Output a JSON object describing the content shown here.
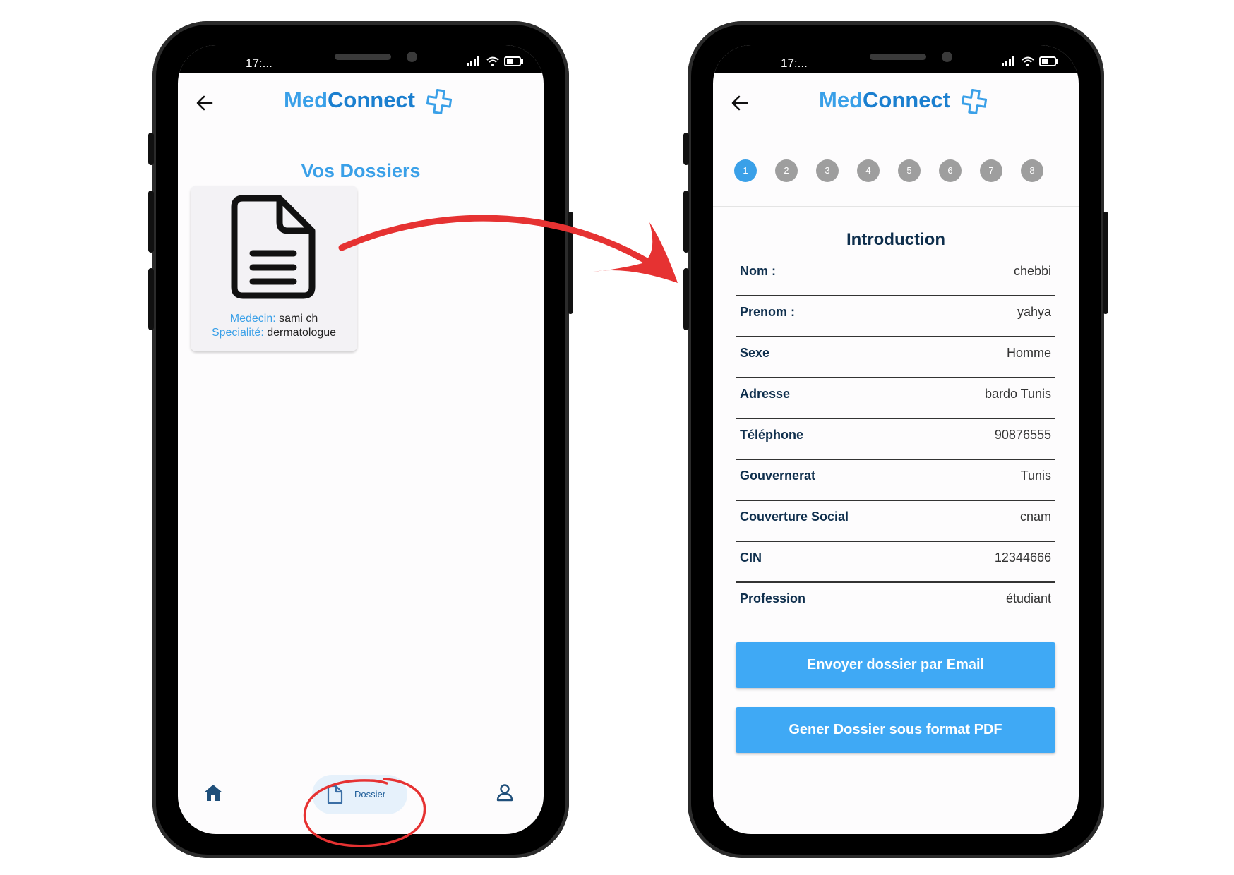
{
  "left_screen": {
    "status_time": "17:...",
    "app_title_part1": "Med",
    "app_title_part2": "Connect",
    "page_title": "Vos Dossiers",
    "card": {
      "medecin_label": "Medecin:",
      "medecin_value": "sami ch",
      "specialite_label": "Specialité:",
      "specialite_value": "dermatologue"
    },
    "nav": {
      "dossier_label": "Dossier"
    }
  },
  "right_screen": {
    "status_time": "17:...",
    "app_title_part1": "Med",
    "app_title_part2": "Connect",
    "steps": [
      "1",
      "2",
      "3",
      "4",
      "5",
      "6",
      "7",
      "8"
    ],
    "active_step": "1",
    "section_title": "Introduction",
    "rows": [
      {
        "label": "Nom :",
        "value": "chebbi"
      },
      {
        "label": "Prenom :",
        "value": "yahya"
      },
      {
        "label": "Sexe",
        "value": "Homme"
      },
      {
        "label": "Adresse",
        "value": "bardo Tunis"
      },
      {
        "label": "Téléphone",
        "value": "90876555"
      },
      {
        "label": "Gouvernerat",
        "value": "Tunis"
      },
      {
        "label": "Couverture Social",
        "value": "cnam"
      },
      {
        "label": "CIN",
        "value": "12344666"
      },
      {
        "label": "Profession",
        "value": "étudiant"
      }
    ],
    "buttons": {
      "email": "Envoyer dossier par Email",
      "pdf": "Gener Dossier sous format PDF"
    }
  },
  "colors": {
    "accent": "#3aa0e8",
    "button": "#3fa9f5",
    "dark_text": "#0f2f4d",
    "annotation_red": "#e63232"
  }
}
